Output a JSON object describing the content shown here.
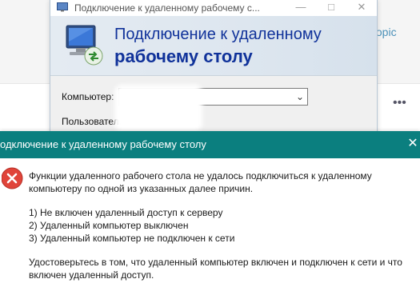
{
  "background_page": {
    "new_topic_text": "w topic",
    "more_icon": "more-horizontal-icon"
  },
  "rdp_window": {
    "title": "Подключение к удаленному рабочему с...",
    "banner_line1": "Подключение к удаленному",
    "banner_line2": "рабочему столу",
    "computer_label": "Компьютер:",
    "computer_value": "",
    "user_label": "Пользователь:",
    "icon": "remote-desktop-icon",
    "controls": [
      "minimize",
      "maximize",
      "close"
    ]
  },
  "error_dialog": {
    "title": "одключение к удаленному рабочему столу",
    "close_glyph": "✕",
    "icon": "error-icon",
    "message_line1": "Функции удаленного рабочего стола не удалось подключиться к удаленному",
    "message_line2": "компьютеру по одной из указанных далее причин.",
    "reasons": [
      "1) Не включен удаленный доступ к серверу",
      "2) Удаленный компьютер выключен",
      "3) Удаленный компьютер не подключен к сети"
    ],
    "advice_line1": "Удостоверьтесь в том, что удаленный компьютер включен и подключен к сети и что",
    "advice_line2": "включен удаленный доступ."
  },
  "colors": {
    "dialog_titlebar": "#0b7f7f",
    "banner_text": "#10329a",
    "error_red": "#e0443a"
  }
}
